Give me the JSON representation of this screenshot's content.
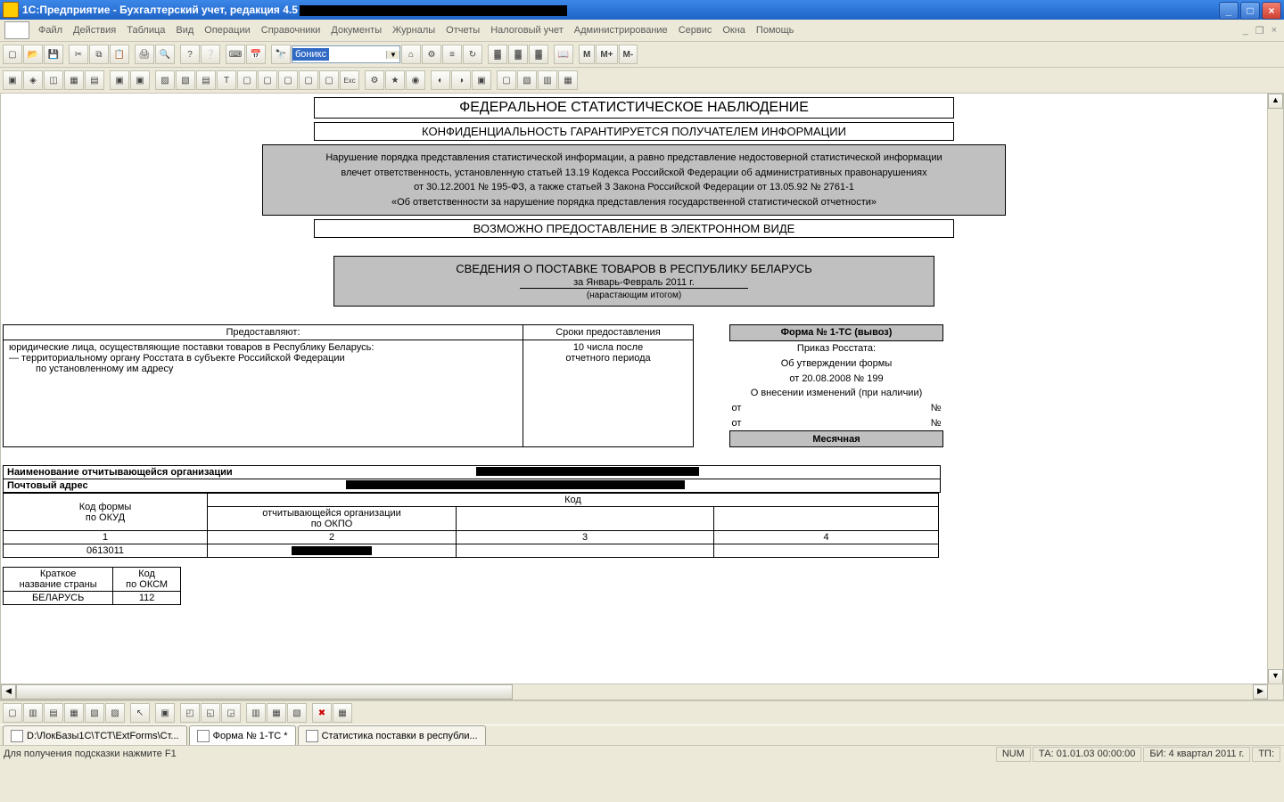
{
  "titlebar": {
    "app": "1С:Предприятие - Бухгалтерский учет, редакция 4.5"
  },
  "menu": [
    "Файл",
    "Действия",
    "Таблица",
    "Вид",
    "Операции",
    "Справочники",
    "Документы",
    "Журналы",
    "Отчеты",
    "Налоговый учет",
    "Администрирование",
    "Сервис",
    "Окна",
    "Помощь"
  ],
  "toolbar1": {
    "search_value": "боникс",
    "m_buttons": [
      "М",
      "М+",
      "М-"
    ]
  },
  "doc": {
    "title": "ФЕДЕРАЛЬНОЕ СТАТИСТИЧЕСКОЕ НАБЛЮДЕНИЕ",
    "confid": "КОНФИДЕНЦИАЛЬНОСТЬ ГАРАНТИРУЕТСЯ ПОЛУЧАТЕЛЕМ ИНФОРМАЦИИ",
    "warn1": "Нарушение порядка представления статистической информации, а равно представление недостоверной статистической информации",
    "warn2": "влечет ответственность, установленную статьей 13.19 Кодекса Российской Федерации об административных правонарушениях",
    "warn3": "от 30.12.2001 № 195-ФЗ, а также статьей 3 Закона Российской Федерации от 13.05.92 № 2761-1",
    "warn4": "«Об ответственности за нарушение порядка представления государственной статистической отчетности»",
    "elec": "ВОЗМОЖНО ПРЕДОСТАВЛЕНИЕ В ЭЛЕКТРОННОМ ВИДЕ",
    "sved": "СВЕДЕНИЯ О ПОСТАВКЕ ТОВАРОВ В РЕСПУБЛИКУ БЕЛАРУСЬ",
    "period": "за Январь-Февраль  2011 г.",
    "accum": "(нарастающим итогом)",
    "table1": {
      "h1": "Предоставляют:",
      "h2": "Сроки предоставления",
      "who1": "юридические лица, осуществляющие поставки товаров в Республику Беларусь:",
      "who2": "— территориальному органу Росстата в субъекте Российской Федерации",
      "who3": "по установленному им адресу",
      "deadline1": "10 числа после",
      "deadline2": "отчетного периода"
    },
    "formbox": {
      "title": "Форма № 1-ТС (вывоз)",
      "l1": "Приказ Росстата:",
      "l2": "Об утверждении формы",
      "l3": "от 20.08.2008 № 199",
      "l4": "О внесении изменений (при наличии)",
      "ot": "от",
      "no": "№",
      "monthly": "Месячная"
    },
    "org_label": "Наименование отчитывающейся организации",
    "addr_label": "Почтовый адрес",
    "codes": {
      "c1a": "Код формы",
      "c1b": "по ОКУД",
      "c2": "Код",
      "c2a": "отчитывающейся организации",
      "c2b": "по ОКПО",
      "n1": "1",
      "n2": "2",
      "n3": "3",
      "n4": "4",
      "v1": "0613011"
    },
    "country": {
      "h1a": "Краткое",
      "h1b": "название страны",
      "h2a": "Код",
      "h2b": "по ОКСМ",
      "name": "БЕЛАРУСЬ",
      "code": "112"
    }
  },
  "tabs": {
    "t1": "D:\\ЛокБазы1С\\ТСТ\\ExtForms\\Ст...",
    "t2": "Форма № 1-ТС  *",
    "t3": "Статистика поставки в республи..."
  },
  "status": {
    "hint": "Для получения подсказки нажмите F1",
    "num": "NUM",
    "ta": "ТА: 01.01.03  00:00:00",
    "bi": "БИ: 4 квартал 2011 г.",
    "tp": "ТП:"
  }
}
